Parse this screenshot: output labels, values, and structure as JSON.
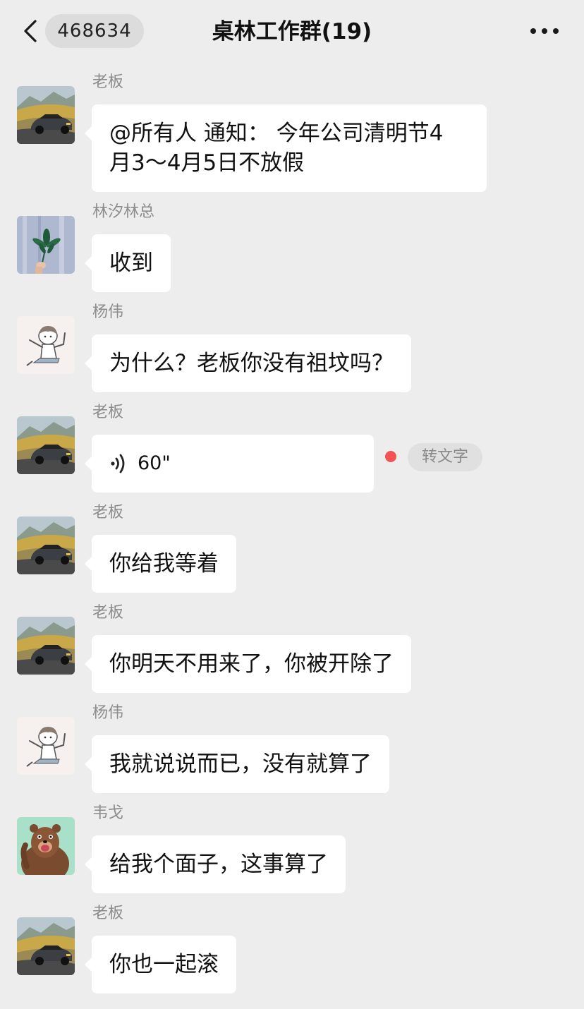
{
  "nav": {
    "unread_count": "468634",
    "title": "桌林工作群(19)",
    "back_icon": "chevron-left-icon",
    "more_icon": "more-dots-icon"
  },
  "messages": [
    {
      "sender": "老板",
      "avatar": "car-landscape-avatar",
      "text": "@所有人 通知： 今年公司清明节4\n月3～4月5日不放假"
    },
    {
      "sender": "林汐林总",
      "avatar": "leaf-hand-avatar",
      "text": "收到"
    },
    {
      "sender": "杨伟",
      "avatar": "cartoon-boy-avatar",
      "text": "为什么？老板你没有祖坟吗？"
    },
    {
      "sender": "老板",
      "avatar": "car-landscape-avatar",
      "voice_duration": "60\"",
      "voice_icon": "voice-wave-icon",
      "unread_dot": true,
      "convert_label": "转文字"
    },
    {
      "sender": "老板",
      "avatar": "car-landscape-avatar",
      "text": "你给我等着"
    },
    {
      "sender": "老板",
      "avatar": "car-landscape-avatar",
      "text": "你明天不用来了，你被开除了"
    },
    {
      "sender": "杨伟",
      "avatar": "cartoon-boy-avatar",
      "text": "我就说说而已，没有就算了"
    },
    {
      "sender": "韦戈",
      "avatar": "brown-bear-avatar",
      "text": "给我个面子，这事算了"
    },
    {
      "sender": "老板",
      "avatar": "car-landscape-avatar",
      "text": "你也一起滚"
    }
  ],
  "colors": {
    "background": "#ededed",
    "bubble": "#ffffff",
    "sender_name": "#8c8c8c",
    "unread_dot": "#f25453"
  }
}
